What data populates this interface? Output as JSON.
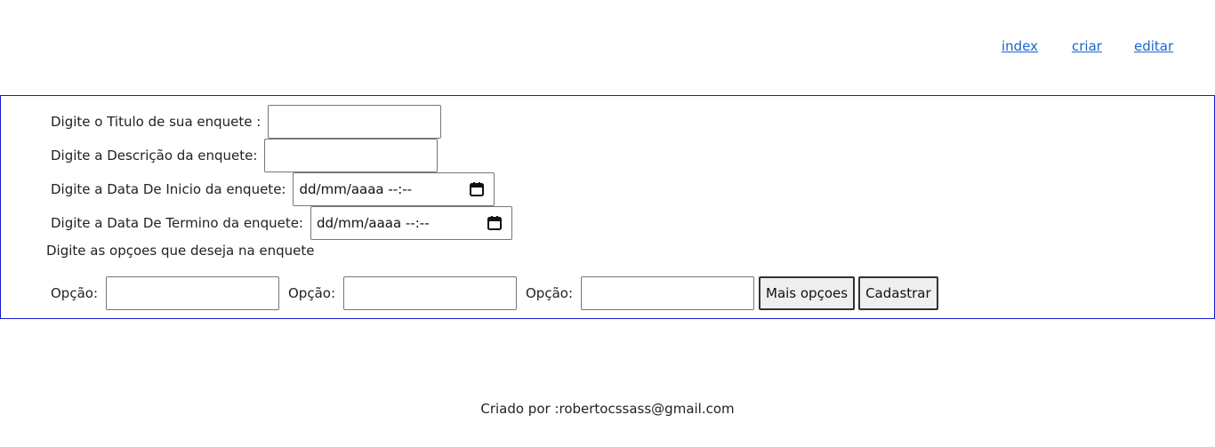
{
  "nav": {
    "links": [
      {
        "label": "index"
      },
      {
        "label": "criar"
      },
      {
        "label": "editar"
      }
    ]
  },
  "form": {
    "title_label": "Digite o Titulo de sua enquete :",
    "title_value": "",
    "description_label": "Digite a Descrição da enquete:",
    "description_value": "",
    "start_label": "Digite a Data De Inicio da enquete:",
    "start_placeholder": "dd/mm/aaaa --:--",
    "end_label": "Digite a Data De Termino da enquete:",
    "end_placeholder": "dd/mm/aaaa --:--",
    "options_prompt": "Digite as opçoes que deseja na enquete",
    "options": [
      {
        "label": "Opção:",
        "value": ""
      },
      {
        "label": "Opção:",
        "value": ""
      },
      {
        "label": "Opção:",
        "value": ""
      }
    ],
    "more_options_button": "Mais opçoes",
    "submit_button": "Cadastrar"
  },
  "footer": {
    "text": "Criado por :robertocssass@gmail.com"
  },
  "colors": {
    "link": "#1a66cc",
    "frame_border": "#1a1acc"
  },
  "icons": {
    "date_picker": "calendar-icon"
  }
}
